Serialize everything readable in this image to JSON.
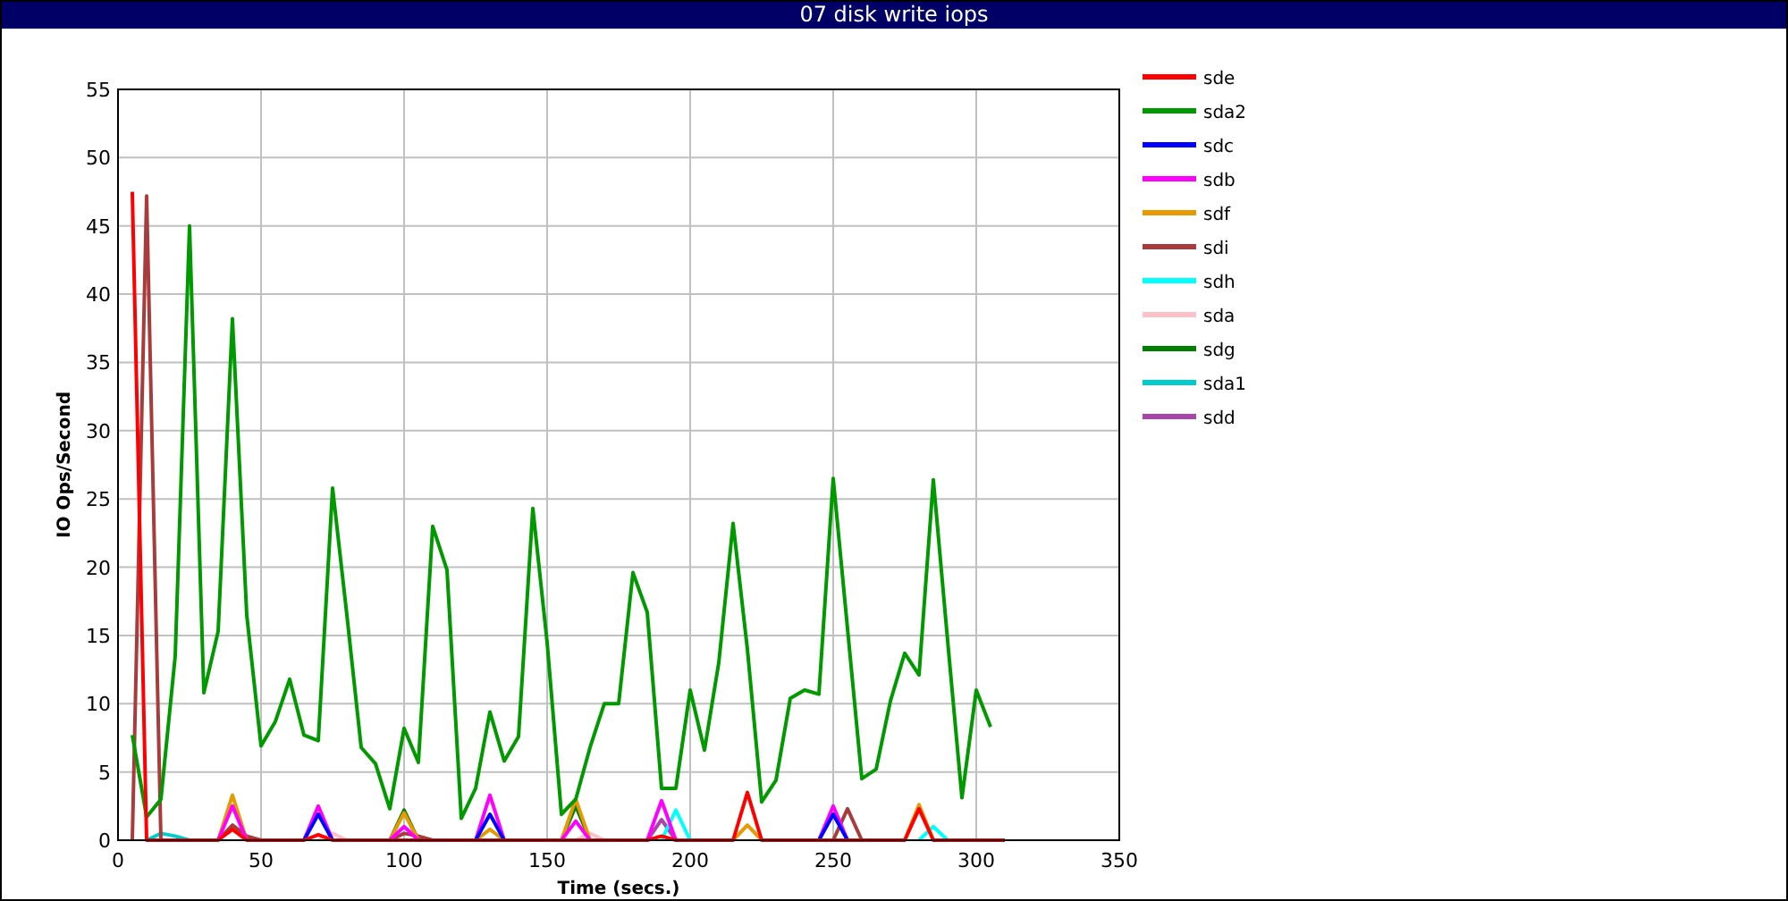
{
  "window": {
    "title": "07 disk write iops"
  },
  "chart_data": {
    "type": "line",
    "xlabel": "Time (secs.)",
    "ylabel": "IO Ops/Second",
    "xlim": [
      0,
      350
    ],
    "ylim": [
      0,
      55
    ],
    "grid": true,
    "legend": "right",
    "xticks": [
      0,
      50,
      100,
      150,
      200,
      250,
      300,
      350
    ],
    "yticks": [
      0,
      5,
      10,
      15,
      20,
      25,
      30,
      35,
      40,
      45,
      50,
      55
    ],
    "x": [
      5,
      10,
      15,
      20,
      25,
      30,
      35,
      40,
      45,
      50,
      55,
      60,
      65,
      70,
      75,
      80,
      85,
      90,
      95,
      100,
      105,
      110,
      115,
      120,
      125,
      130,
      135,
      140,
      145,
      150,
      155,
      160,
      165,
      170,
      175,
      180,
      185,
      190,
      195,
      200,
      205,
      210,
      215,
      220,
      225,
      230,
      235,
      240,
      245,
      250,
      255,
      260,
      265,
      270,
      275,
      280,
      285,
      290,
      295,
      300,
      305,
      310
    ],
    "series": [
      {
        "name": "sde",
        "color": "#ff0000",
        "values": [
          47.5,
          0,
          0,
          0,
          0,
          0,
          0,
          0.8,
          0,
          0,
          0,
          0,
          0,
          0.4,
          0,
          0,
          0,
          0,
          0,
          0,
          0,
          0,
          0,
          0,
          0,
          0,
          0,
          0,
          0,
          0,
          0,
          0,
          0,
          0,
          0,
          0,
          0,
          0.3,
          0,
          0,
          0,
          0,
          0,
          3.5,
          0,
          0,
          0,
          0,
          0,
          0,
          0,
          0,
          0,
          0,
          0,
          2.3,
          0,
          0,
          0,
          0,
          0,
          0
        ]
      },
      {
        "name": "sda2",
        "color": "#009900",
        "values": [
          7.7,
          1.7,
          3,
          13.5,
          45,
          10.8,
          15.3,
          38.2,
          16.5,
          6.9,
          8.7,
          11.8,
          7.7,
          7.3,
          25.8,
          16.5,
          6.8,
          5.6,
          2.3,
          8.2,
          5.7,
          23,
          19.8,
          1.6,
          3.8,
          9.4,
          5.8,
          7.6,
          24.3,
          14.5,
          1.9,
          3,
          6.8,
          10,
          10,
          19.6,
          16.7,
          3.8,
          3.8,
          11,
          6.6,
          13,
          23.2,
          14,
          2.8,
          4.4,
          10.4,
          11,
          10.7,
          26.5,
          15.5,
          4.5,
          5.2,
          10.2,
          13.7,
          12.1,
          26.4,
          14.6,
          3.1,
          11,
          8.3,
          null
        ]
      },
      {
        "name": "sdc",
        "color": "#0000ff",
        "values": [
          null,
          null,
          null,
          null,
          null,
          null,
          null,
          null,
          null,
          null,
          null,
          null,
          0,
          1.9,
          0,
          null,
          null,
          null,
          null,
          null,
          null,
          null,
          null,
          null,
          0,
          1.9,
          0,
          null,
          null,
          null,
          null,
          null,
          null,
          null,
          null,
          null,
          null,
          null,
          null,
          null,
          null,
          null,
          null,
          null,
          null,
          null,
          null,
          null,
          0,
          1.9,
          0,
          null,
          null,
          null,
          null,
          null,
          null,
          null,
          null,
          null,
          null,
          null
        ]
      },
      {
        "name": "sdb",
        "color": "#ff00ff",
        "values": [
          null,
          null,
          null,
          null,
          null,
          null,
          0,
          2.5,
          0,
          null,
          null,
          null,
          0,
          2.5,
          0,
          null,
          null,
          null,
          0,
          1,
          0,
          null,
          null,
          null,
          0,
          3.3,
          0,
          null,
          null,
          null,
          0,
          1.4,
          0,
          null,
          null,
          null,
          0,
          2.9,
          0,
          null,
          null,
          null,
          null,
          null,
          null,
          null,
          null,
          null,
          0,
          2.5,
          0,
          null,
          null,
          null,
          null,
          null,
          null,
          null,
          null,
          null,
          null,
          null
        ]
      },
      {
        "name": "sdf",
        "color": "#e69900",
        "values": [
          null,
          null,
          null,
          null,
          null,
          null,
          0,
          3.3,
          0,
          null,
          null,
          null,
          null,
          null,
          null,
          null,
          null,
          null,
          0,
          2,
          0,
          null,
          null,
          null,
          0,
          0.8,
          0,
          null,
          null,
          null,
          0,
          3,
          0,
          null,
          null,
          null,
          null,
          null,
          null,
          null,
          null,
          null,
          0,
          1.1,
          0,
          null,
          null,
          null,
          null,
          null,
          null,
          null,
          null,
          null,
          0,
          2.6,
          0,
          null,
          null,
          null,
          null,
          null
        ]
      },
      {
        "name": "sdi",
        "color": "#a83c3c",
        "values": [
          0,
          47.2,
          0,
          null,
          null,
          null,
          0,
          1.1,
          0.3,
          0,
          null,
          null,
          null,
          null,
          null,
          null,
          null,
          null,
          0,
          0.5,
          0.3,
          0,
          null,
          null,
          null,
          null,
          null,
          null,
          null,
          null,
          null,
          null,
          null,
          null,
          null,
          null,
          null,
          null,
          null,
          null,
          null,
          null,
          null,
          null,
          null,
          null,
          null,
          null,
          null,
          0,
          2.3,
          0,
          null,
          null,
          null,
          null,
          null,
          null,
          null,
          null,
          null,
          null
        ]
      },
      {
        "name": "sdh",
        "color": "#00ffff",
        "values": [
          null,
          null,
          null,
          null,
          null,
          null,
          null,
          null,
          null,
          null,
          null,
          null,
          null,
          null,
          null,
          null,
          null,
          null,
          null,
          null,
          null,
          null,
          null,
          null,
          null,
          null,
          null,
          null,
          null,
          null,
          null,
          null,
          null,
          null,
          null,
          null,
          null,
          0,
          2.2,
          0,
          null,
          null,
          null,
          null,
          null,
          null,
          null,
          null,
          null,
          null,
          null,
          null,
          null,
          null,
          null,
          0,
          1,
          0,
          null,
          null,
          null,
          null
        ]
      },
      {
        "name": "sda",
        "color": "#ffc0cb",
        "values": [
          null,
          null,
          null,
          null,
          null,
          null,
          null,
          null,
          null,
          null,
          null,
          null,
          null,
          0,
          0.5,
          0,
          null,
          null,
          null,
          null,
          null,
          null,
          null,
          null,
          null,
          null,
          null,
          null,
          null,
          null,
          null,
          0,
          0.5,
          0,
          null,
          null,
          null,
          null,
          null,
          null,
          null,
          null,
          null,
          null,
          null,
          null,
          null,
          null,
          null,
          null,
          null,
          null,
          null,
          null,
          null,
          null,
          null,
          null,
          null,
          null,
          null,
          null
        ]
      },
      {
        "name": "sdg",
        "color": "#008000",
        "values": [
          null,
          null,
          null,
          null,
          null,
          null,
          null,
          null,
          null,
          null,
          null,
          null,
          null,
          null,
          null,
          null,
          null,
          null,
          0,
          2.2,
          0,
          null,
          null,
          null,
          null,
          null,
          null,
          null,
          null,
          null,
          0,
          2.5,
          0,
          null,
          null,
          null,
          null,
          null,
          null,
          null,
          null,
          null,
          null,
          null,
          null,
          null,
          null,
          null,
          null,
          null,
          null,
          null,
          null,
          null,
          null,
          null,
          null,
          null,
          null,
          null,
          null,
          null
        ]
      },
      {
        "name": "sda1",
        "color": "#00cccc",
        "values": [
          null,
          0,
          0.5,
          0.3,
          0,
          null,
          null,
          null,
          null,
          null,
          null,
          null,
          null,
          null,
          null,
          null,
          null,
          null,
          null,
          null,
          null,
          null,
          null,
          null,
          null,
          null,
          null,
          null,
          null,
          null,
          null,
          null,
          null,
          null,
          null,
          null,
          null,
          null,
          null,
          null,
          null,
          null,
          null,
          null,
          null,
          null,
          null,
          null,
          null,
          null,
          null,
          null,
          null,
          null,
          null,
          null,
          null,
          null,
          null,
          null,
          null,
          null
        ]
      },
      {
        "name": "sdd",
        "color": "#aa44aa",
        "values": [
          null,
          null,
          null,
          null,
          null,
          null,
          null,
          null,
          null,
          null,
          null,
          null,
          null,
          null,
          null,
          null,
          null,
          null,
          null,
          null,
          null,
          null,
          null,
          null,
          null,
          null,
          null,
          null,
          null,
          null,
          null,
          null,
          null,
          null,
          null,
          null,
          0,
          1.5,
          0,
          null,
          null,
          null,
          null,
          null,
          null,
          null,
          null,
          null,
          null,
          null,
          null,
          null,
          null,
          null,
          null,
          null,
          null,
          null,
          null,
          null,
          null,
          null
        ]
      }
    ]
  }
}
